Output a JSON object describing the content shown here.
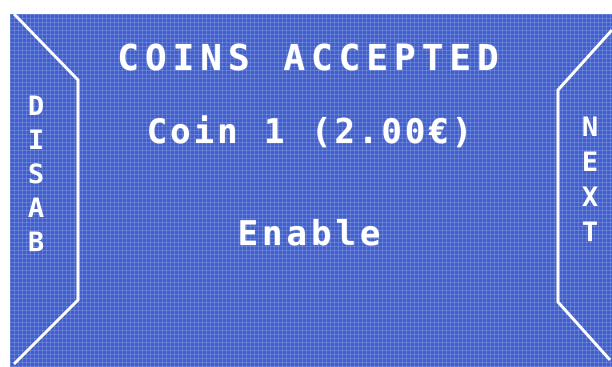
{
  "screen": {
    "title": "COINS ACCEPTED",
    "coin_line": "Coin 1 (2.00€)",
    "status": "Enable"
  },
  "left_button": {
    "label": "DISAB",
    "chars": [
      "D",
      "I",
      "S",
      "A",
      "B"
    ]
  },
  "right_button": {
    "label": "NEXT",
    "chars": [
      "N",
      "E",
      "X",
      "T"
    ]
  },
  "colors": {
    "lcd_background": "#3f5fcf",
    "lcd_text": "#ffffff",
    "outer": "#ffffff"
  }
}
